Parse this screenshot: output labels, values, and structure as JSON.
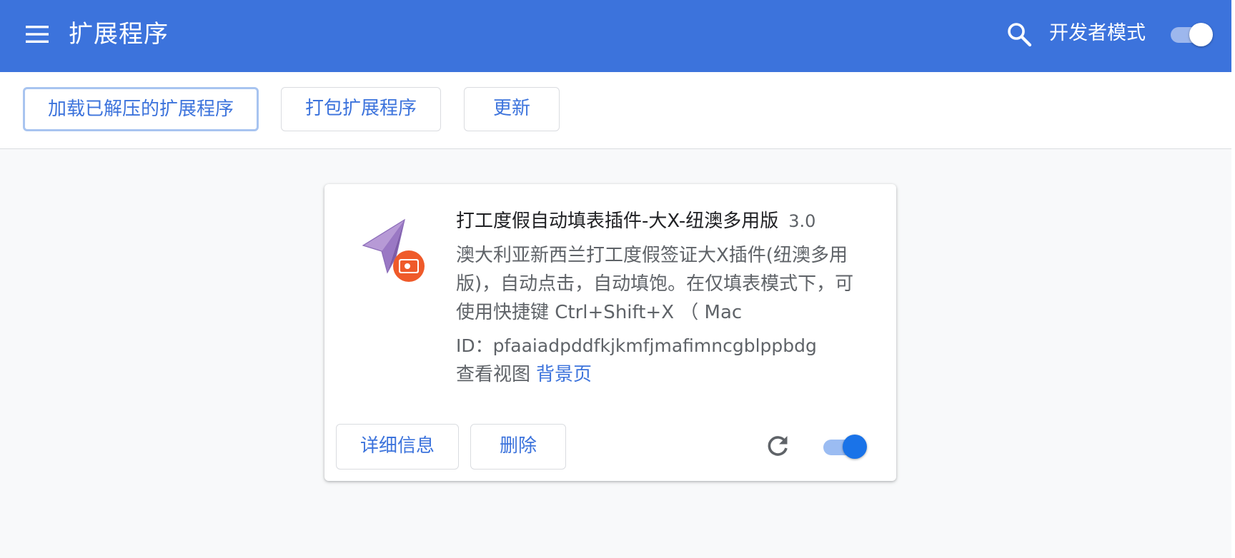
{
  "header": {
    "title": "扩展程序",
    "menu_icon": "menu-icon",
    "search_icon": "search-icon",
    "developer_mode_label": "开发者模式",
    "developer_mode_enabled": true,
    "background_color": "#3c73dc"
  },
  "toolbar": {
    "load_unpacked_label": "加载已解压的扩展程序",
    "pack_label": "打包扩展程序",
    "update_label": "更新"
  },
  "extension": {
    "name": "打工度假自动填表插件-大X-纽澳多用版",
    "version": "3.0",
    "description": "澳大利亚新西兰打工度假签证大X插件(纽澳多用版)，自动点击，自动填饱。在仅填表模式下，可使用快捷键 Ctrl+Shift+X （ Mac",
    "id_text": "ID：pfaaiadpddfkjkmfjmafimncgblppbdg",
    "views_label": "查看视图",
    "views_link": "背景页",
    "details_label": "详细信息",
    "remove_label": "删除",
    "icon": "paper-plane-icon",
    "badge_icon": "record-badge-icon",
    "reload_icon": "reload-icon",
    "enabled": true,
    "accent_color": "#1a73e8"
  }
}
